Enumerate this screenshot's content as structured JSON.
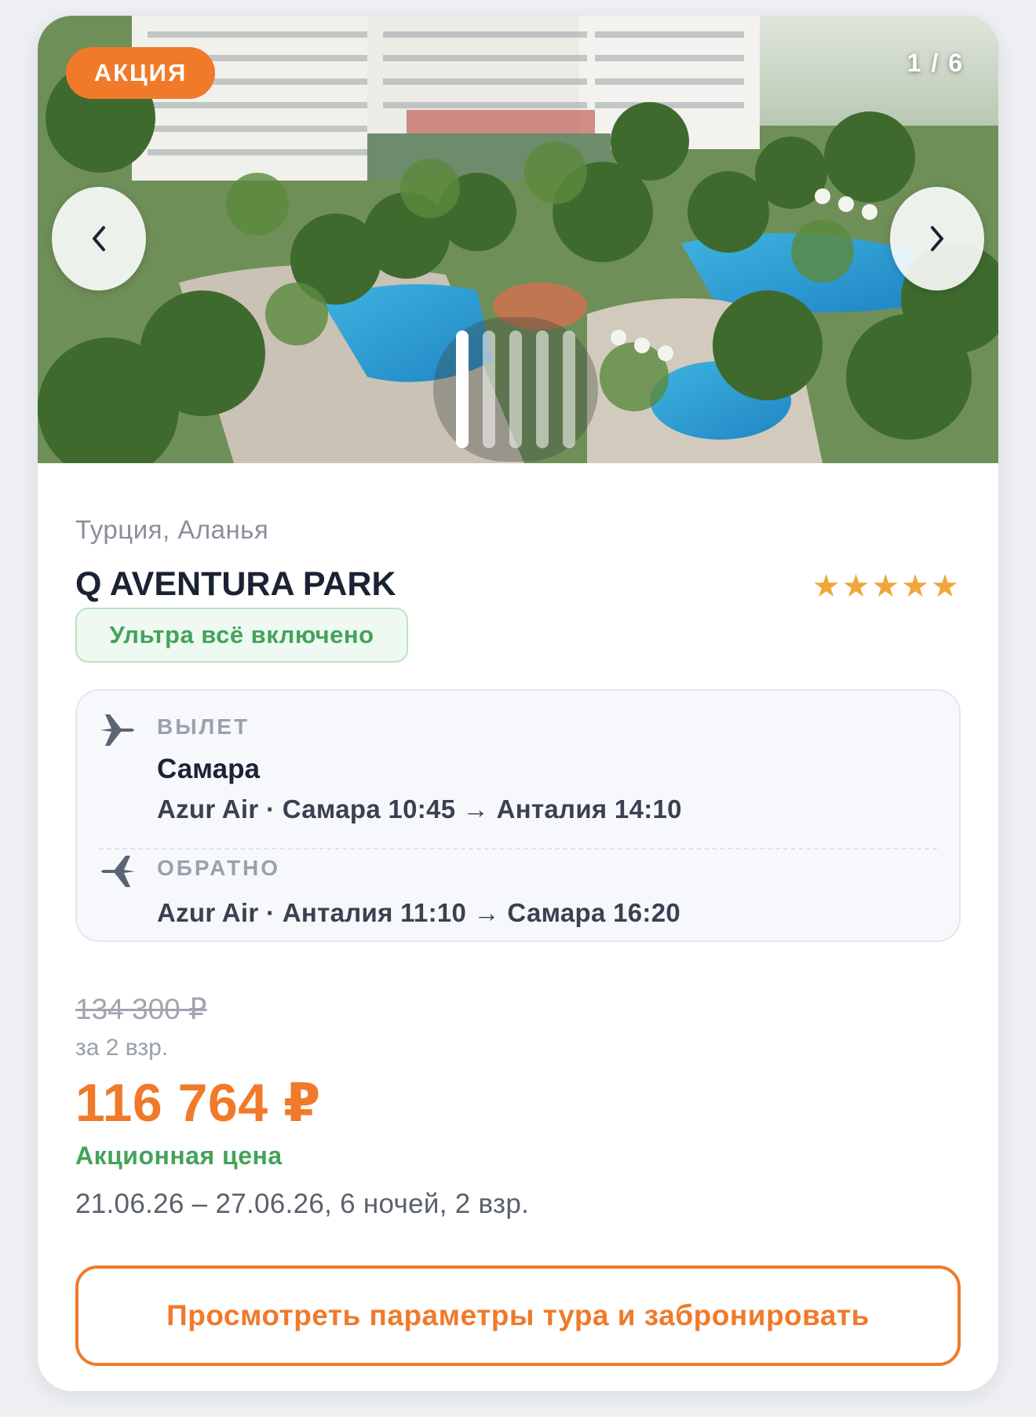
{
  "gallery": {
    "sale_badge": "АКЦИЯ",
    "counter": "1 / 6",
    "prev_icon": "chevron-left-icon",
    "next_icon": "chevron-right-icon",
    "dots": 5,
    "active_dot": 1
  },
  "hotel": {
    "location": "Турция, Аланья",
    "name": "Q AVENTURA PARK",
    "stars": "★★★★★",
    "star_count": 5,
    "meal_plan": "Ультра всё включено"
  },
  "flights": {
    "outbound": {
      "label": "ВЫЛЕТ",
      "city": "Самара",
      "route": "Azur Air · Самара 10:45 → Анталия 14:10",
      "icon": "plane-departure-icon"
    },
    "return": {
      "label": "ОБРАТНО",
      "route": "Azur Air · Анталия 11:10 → Самара 16:20",
      "icon": "plane-arrival-icon"
    }
  },
  "pricing": {
    "old_price": "134 300 ₽",
    "per_adults": "за 2 взр.",
    "price": "116 764 ₽",
    "promo_label": "Акционная цена",
    "dates": "21.06.26 – 27.06.26, 6 ночей, 2 взр."
  },
  "cta": {
    "label": "Просмотреть параметры тура и забронировать"
  },
  "colors": {
    "accent": "#f07a2a",
    "green": "#43a35a",
    "stars": "#f0a63a",
    "text_dark": "#1b2233"
  }
}
